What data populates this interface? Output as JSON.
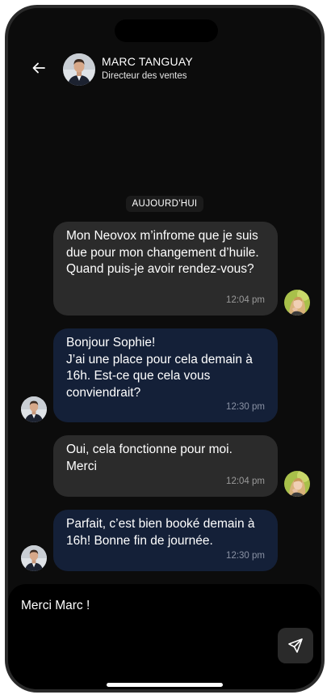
{
  "header": {
    "back_icon": "arrow-left-icon",
    "contact_name": "MARC TANGUAY",
    "contact_role": "Directeur des ventes"
  },
  "conversation": {
    "day_separator": "AUJOURD'HUI",
    "messages": [
      {
        "sender": "Sophie",
        "text": "Mon Neovox m’infrome que je suis due pour mon changement d’huile. Quand puis-je avoir rendez-vous?",
        "time": "12:04 pm"
      },
      {
        "sender": "Marc Tanguay",
        "text": "Bonjour Sophie!\nJ’ai une place pour cela demain à 16h. Est-ce que cela vous conviendrait?",
        "time": "12:30 pm"
      },
      {
        "sender": "Sophie",
        "text": "Oui, cela fonctionne pour moi. Merci",
        "time": "12:04 pm"
      },
      {
        "sender": "Marc Tanguay",
        "text": "Parfait, c’est bien booké demain à 16h! Bonne fin de journée.",
        "time": "12:30 pm"
      }
    ]
  },
  "composer": {
    "value": "Merci Marc !",
    "send_icon": "send-icon"
  },
  "colors": {
    "background": "#0c0c0c",
    "incoming_bubble": "#2b2b2b",
    "outgoing_bubble": "#142038",
    "timestamp": "#9a9a9a"
  }
}
